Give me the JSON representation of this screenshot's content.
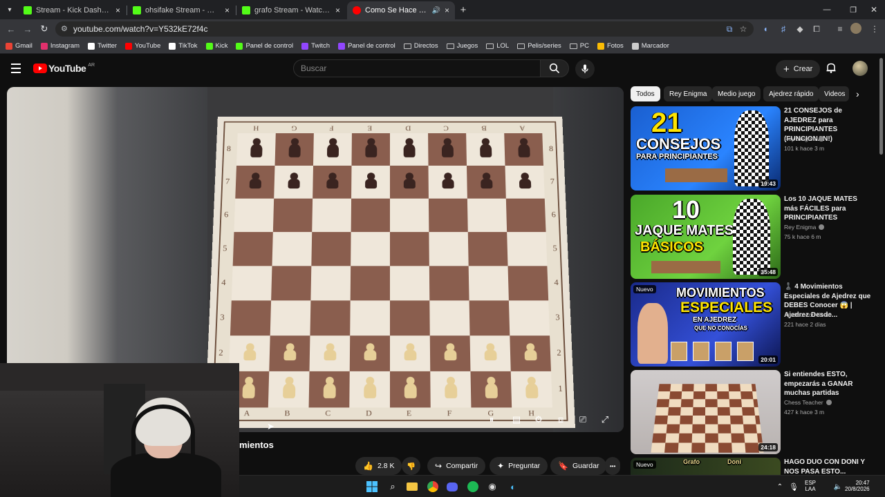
{
  "browser": {
    "tabs": [
      {
        "title": "Stream - Kick Dashboard",
        "favicon_color": "#53fc18",
        "close": "×"
      },
      {
        "title": "ohsifake Stream - Watch Live on Kick",
        "favicon_color": "#53fc18",
        "close": "×"
      },
      {
        "title": "grafo Stream - Watch Live on Kick",
        "favicon_color": "#53fc18",
        "close": "×"
      },
      {
        "title": "Como Se Hace El Jaque Mate",
        "favicon_color": "#ff0000",
        "close": "×",
        "active": true
      }
    ],
    "new_tab": "+",
    "url": "youtube.com/watch?v=Y532kE72f4c",
    "bookmarks": [
      {
        "label": "Gmail",
        "icon": "gmail-icon",
        "color": "#ea4335"
      },
      {
        "label": "Instagram",
        "icon": "instagram-icon",
        "color": "#e1306c"
      },
      {
        "label": "Twitter",
        "icon": "x-icon",
        "color": "#ffffff"
      },
      {
        "label": "YouTube",
        "icon": "youtube-icon",
        "color": "#ff0000"
      },
      {
        "label": "TikTok",
        "icon": "tiktok-icon",
        "color": "#ffffff"
      },
      {
        "label": "Kick",
        "icon": "kick-icon",
        "color": "#53fc18"
      },
      {
        "label": "Panel de control",
        "icon": "kick-icon",
        "color": "#53fc18"
      },
      {
        "label": "Twitch",
        "icon": "twitch-icon",
        "color": "#9146ff"
      },
      {
        "label": "Panel de control",
        "icon": "twitch-icon",
        "color": "#9146ff"
      },
      {
        "label": "Directos",
        "icon": "folder-icon",
        "color": ""
      },
      {
        "label": "Juegos",
        "icon": "folder-icon",
        "color": ""
      },
      {
        "label": "LOL",
        "icon": "folder-icon",
        "color": ""
      },
      {
        "label": "Pelis/series",
        "icon": "folder-icon",
        "color": ""
      },
      {
        "label": "PC",
        "icon": "folder-icon",
        "color": ""
      },
      {
        "label": "Fotos",
        "icon": "photos-icon",
        "color": "#fbbc04"
      },
      {
        "label": "Marcador",
        "icon": "globe-icon",
        "color": "#cccccc"
      }
    ]
  },
  "youtube": {
    "logo_text": "YouTube",
    "region": "AR",
    "search_placeholder": "Buscar",
    "create_label": "Crear",
    "video_title_fragment": "mientos",
    "actions": {
      "likes": "2.8 K",
      "share": "Compartir",
      "ask": "Preguntar",
      "save": "Guardar",
      "more": "•••"
    },
    "chips": [
      "Todos",
      "Rey Enigma",
      "Medio juego",
      "Ajedrez rápido",
      "Videos"
    ],
    "board": {
      "ranks": [
        "8",
        "7",
        "6",
        "5",
        "4",
        "3",
        "2",
        "1"
      ],
      "files": [
        "A",
        "B",
        "C",
        "D",
        "E",
        "F",
        "G",
        "H"
      ],
      "top_files": [
        "H",
        "G",
        "F",
        "E",
        "D",
        "C",
        "B",
        "A"
      ]
    },
    "recommendations": [
      {
        "title": "21 CONSEJOS de AJEDREZ para PRINCIPIANTES (FUNCIONAN!)",
        "channel": "Rey Enigma",
        "meta": "101 k  hace 3 m",
        "duration": "19:43",
        "thumb_line1": "21",
        "thumb_line2": "CONSEJOS",
        "thumb_line3": "PARA PRINCIPIANTES"
      },
      {
        "title": "Los 10 JAQUE MATES más FÁCILES para PRINCIPIANTES",
        "channel": "Rey Enigma",
        "meta": "75 k  hace 6 m",
        "duration": "35:48",
        "thumb_line1": "10",
        "thumb_line2": "JAQUE MATES",
        "thumb_line3": "BÁSICOS"
      },
      {
        "title": "♟️ 4 Movimientos Especiales de Ajedrez que DEBES Conocer 😱 | Ajedrez Desde...",
        "channel": "Ajedrez con Kevin",
        "meta": "221  hace 2 días",
        "duration": "20:01",
        "badge": "Nuevo",
        "thumb_line1": "MOVIMIENTOS",
        "thumb_line2": "ESPECIALES",
        "thumb_line3": "EN AJEDREZ",
        "thumb_line4": "QUE NO CONOCÍAS"
      },
      {
        "title": "Si entiendes ESTO, empezarás a GANAR muchas partidas",
        "channel": "Chess Teacher",
        "meta": "427 k  hace 3 m",
        "duration": "24:18"
      },
      {
        "title": "HAGO DUO CON DONI Y NOS PASA ESTO...",
        "badge": "Nuevo",
        "thumb_line1": "Grafo",
        "thumb_line2": "Doni"
      }
    ]
  },
  "taskbar": {
    "lang_line1": "ESP",
    "lang_line2": "LAA",
    "time": "20:47",
    "date": "20/8/2026"
  }
}
